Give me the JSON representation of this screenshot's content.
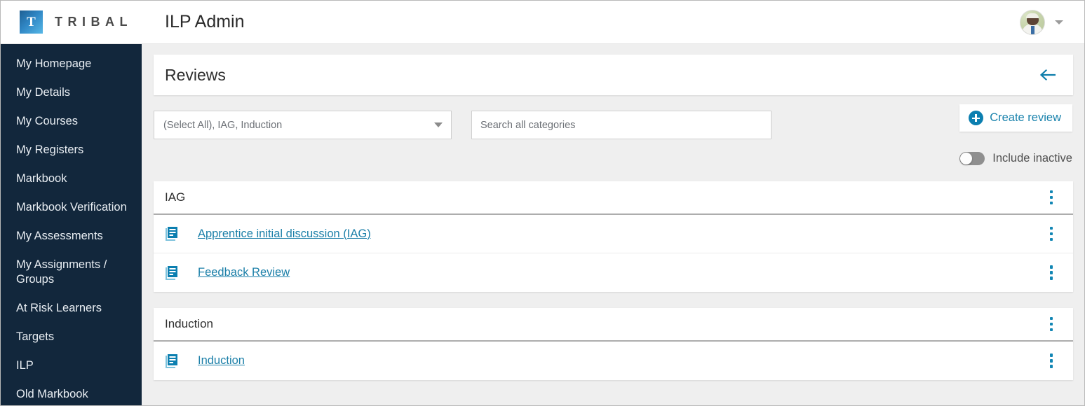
{
  "topbar": {
    "brand_mark_letter": "T",
    "brand_word": "TRIBAL",
    "app_title": "ILP Admin",
    "avatar_name": "user-avatar",
    "account_caret": "chevron-down-icon"
  },
  "sidebar": {
    "items": [
      {
        "label": "My Homepage"
      },
      {
        "label": "My Details"
      },
      {
        "label": "My Courses"
      },
      {
        "label": "My Registers"
      },
      {
        "label": "Markbook"
      },
      {
        "label": "Markbook Verification"
      },
      {
        "label": "My Assessments"
      },
      {
        "label": "My Assignments /\nGroups"
      },
      {
        "label": "At Risk Learners"
      },
      {
        "label": "Targets"
      },
      {
        "label": "ILP"
      },
      {
        "label": "Old Markbook"
      }
    ]
  },
  "page": {
    "title": "Reviews",
    "back_icon": "arrow-left-icon"
  },
  "filters": {
    "category_select_value": "(Select All), IAG, Induction",
    "search_placeholder": "Search all categories",
    "search_value": "",
    "create_review_label": "Create review",
    "include_inactive_label": "Include inactive",
    "include_inactive_on": false
  },
  "groups": [
    {
      "title": "IAG",
      "reviews": [
        {
          "name": "Apprentice initial discussion (IAG)"
        },
        {
          "name": "Feedback Review"
        }
      ]
    },
    {
      "title": "Induction",
      "reviews": [
        {
          "name": "Induction"
        }
      ]
    }
  ],
  "colors": {
    "sidebar_bg": "#12273c",
    "link_blue": "#1b7fa8",
    "accent_blue": "#0c7fb0",
    "page_bg": "#efefef"
  }
}
